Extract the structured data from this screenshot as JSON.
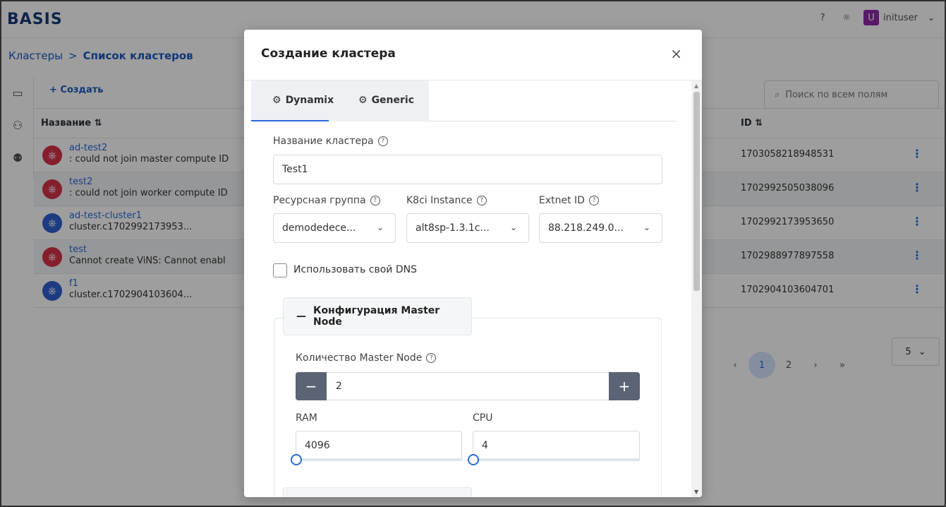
{
  "app": {
    "logo": "BASIS",
    "user": {
      "avatar_letter": "U",
      "name": "inituser"
    }
  },
  "breadcrumb": {
    "root": "Кластеры",
    "sep": ">",
    "current": "Список кластеров"
  },
  "toolbar": {
    "create_label": "+ Создать",
    "search_placeholder": "Поиск по всем полям"
  },
  "table": {
    "col_name": "Название ⇅",
    "col_id": "ID ⇅",
    "rows": [
      {
        "name": "ad-test2",
        "status": ": could not join master compute ID",
        "id": "1703058218948531",
        "state": "error"
      },
      {
        "name": "test2",
        "status": ": could not join worker compute ID",
        "id": "1702992505038096",
        "state": "error"
      },
      {
        "name": "ad-test-cluster1",
        "status": "cluster.c1702992173953...",
        "id": "1702992173953650",
        "state": "ok"
      },
      {
        "name": "test",
        "status": "Cannot create ViNS: Cannot enabl",
        "id": "1702988977897558",
        "state": "error"
      },
      {
        "name": "f1",
        "status": "cluster.c1702904103604...",
        "id": "1702904103604701",
        "state": "ok"
      }
    ]
  },
  "pager": {
    "prev": "‹",
    "pages": [
      "1",
      "2"
    ],
    "active": "1",
    "next": "›",
    "last": "»",
    "per_page": "5"
  },
  "colors": {
    "accent": "#2d6ad6",
    "error": "#d6324a",
    "ok": "#2f5fd0",
    "avatar": "#8e2aa6"
  },
  "modal": {
    "title": "Создание кластера",
    "close": "×",
    "tabs": [
      "Dynamix",
      "Generic"
    ],
    "active_tab": "Dynamix",
    "cluster_name_label": "Название кластера",
    "cluster_name_value": "Test1",
    "resource_group_label": "Ресурсная группа",
    "resource_group_value": "demodedece...",
    "k8ci_label": "K8ci Instance",
    "k8ci_value": "alt8sp-1.3.1c...",
    "extnet_label": "Extnet ID",
    "extnet_value": "88.218.249.0...",
    "dns_label": "Использовать свой DNS",
    "dns_checked": false,
    "master_section": "Конфигурация Master Node",
    "master_count_label": "Количество Master Node",
    "master_count_value": "2",
    "ram_label": "RAM",
    "ram_value": "4096",
    "cpu_label": "CPU",
    "cpu_value": "4"
  }
}
